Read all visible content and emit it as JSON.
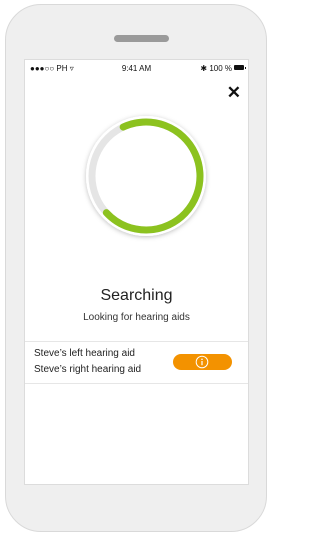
{
  "statusbar": {
    "carrier": "●●●○○ PH ▿",
    "time": "9:41 AM",
    "battery": "✱ 100 %"
  },
  "close_label": "✕",
  "search": {
    "title": "Searching",
    "subtitle": "Looking for hearing aids",
    "progress_fraction": 0.7,
    "accent_color": "#8cc21f",
    "track_color": "#e5e5e5"
  },
  "devices": {
    "left": "Steve’s left hearing aid",
    "right": "Steve’s right hearing aid",
    "info_icon": "info-icon",
    "button_color": "#f39200"
  }
}
